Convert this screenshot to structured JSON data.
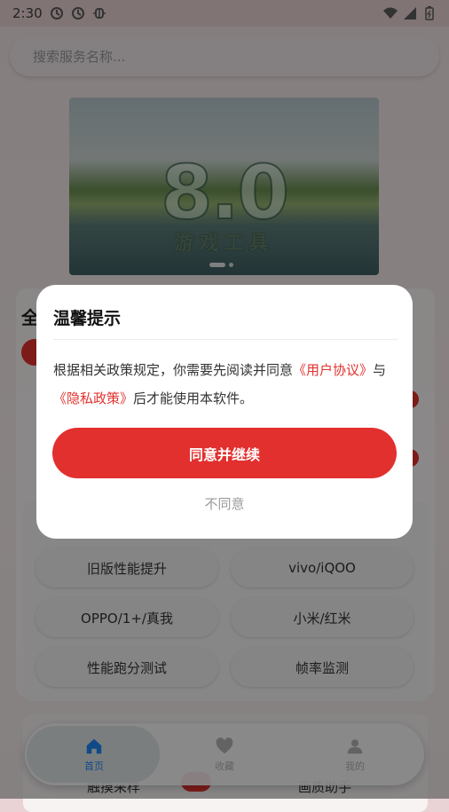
{
  "status_bar": {
    "time": "2:30",
    "icons_left": [
      "sync-icon",
      "sync-icon",
      "debug-icon"
    ],
    "icons_right": [
      "wifi-icon",
      "signal-icon",
      "battery-icon"
    ]
  },
  "search": {
    "placeholder": "搜索服务名称..."
  },
  "banner": {
    "title": "8.0",
    "subtitle": "游戏工具",
    "slides": 2,
    "active_slide": 0
  },
  "section": {
    "title": "全"
  },
  "grid": {
    "items": [
      "旧版性能提升",
      "vivo/iQOO",
      "OPPO/1+/真我",
      "小米/红米",
      "性能跑分测试",
      "帧率监测"
    ]
  },
  "bottom_card": {
    "left_text": "触摸采样",
    "right_text": "画质助手"
  },
  "tabbar": {
    "items": [
      {
        "label": "首页",
        "icon": "home-icon",
        "active": true
      },
      {
        "label": "收藏",
        "icon": "heart-icon",
        "active": false
      },
      {
        "label": "我的",
        "icon": "user-icon",
        "active": false
      }
    ],
    "active_color": "#1e88f5",
    "inactive_color": "#b5b5b5"
  },
  "dialog": {
    "title": "温馨提示",
    "body_prefix": "根据相关政策规定，你需要先阅读并同意",
    "link_user": "《用户协议》",
    "body_mid": "与",
    "link_privacy": "《隐私政策》",
    "body_suffix": "后才能使用本软件。",
    "agree_label": "同意并继续",
    "disagree_label": "不同意",
    "accent_color": "#e2302f"
  }
}
